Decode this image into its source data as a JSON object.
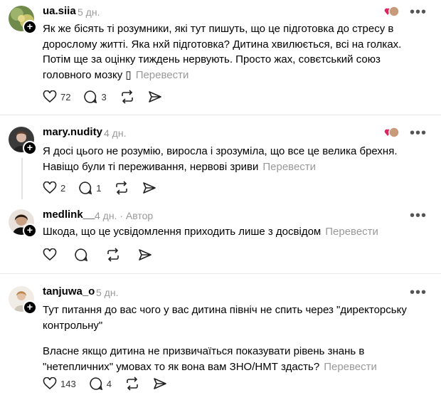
{
  "translate_label": "Перевести",
  "posts": [
    {
      "username": "ua.siia",
      "time": "5 дн.",
      "author_tag": "",
      "paragraphs": [
        "Як же бісять ті розумники, які тут пишуть, що це підготовка до стресу в дорослому житті. Яка нхй підготовка? Дитина хвилюється, всі на голках. Потім ще за оцінку тиждень нервують. Просто жах, совєтський союз головного мозку ▯"
      ],
      "likes": "72",
      "replies": "3"
    },
    {
      "username": "mary.nudity",
      "time": "4 дн.",
      "author_tag": "",
      "paragraphs": [
        "Я досі цього не розумію, виросла і зрозуміла, що все це велика брехня. Навіщо були ті переживання, нервові зриви"
      ],
      "likes": "2",
      "replies": "1"
    },
    {
      "username": "medlink__",
      "time": "4 дн.",
      "author_tag": "· Автор",
      "paragraphs": [
        "Шкода, що це усвідомлення приходить лише з досвідом"
      ],
      "likes": "",
      "replies": ""
    },
    {
      "username": "tanjuwa_o",
      "time": "5 дн.",
      "author_tag": "",
      "paragraphs": [
        "Тут питання до вас чого у вас дитина північ не спить через \"директорську контрольну\"",
        "Власне якщо дитина не призвичаїться показувати рівень знань в \"нетепличних\" умовах то як вона вам ЗНО/НМТ здасть?"
      ],
      "likes": "143",
      "replies": "4"
    }
  ],
  "colors": {
    "muted": "#999999",
    "separator": "#e7e7e7",
    "heart": "#e0245e"
  }
}
